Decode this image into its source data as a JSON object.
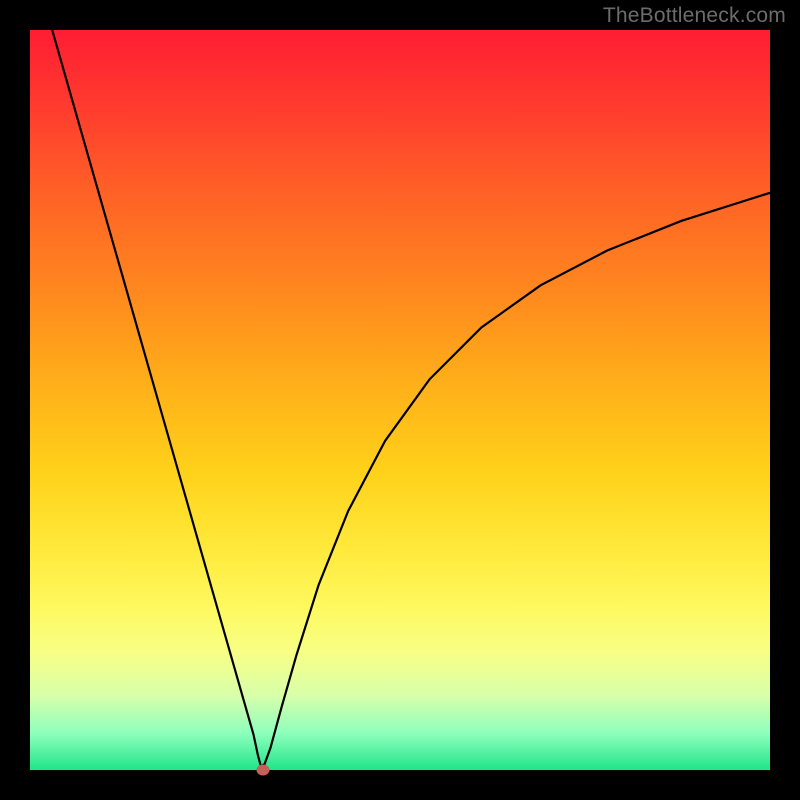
{
  "watermark": "TheBottleneck.com",
  "chart_data": {
    "type": "line",
    "title": "",
    "xlabel": "",
    "ylabel": "",
    "xlim": [
      0,
      100
    ],
    "ylim": [
      0,
      100
    ],
    "grid": false,
    "legend": false,
    "background_gradient": {
      "top_color": "#ff1d33",
      "mid_color": "#ffe93b",
      "bottom_color": "#1fe589"
    },
    "marker": {
      "x": 31.5,
      "y": 0,
      "color": "#c46058"
    },
    "series": [
      {
        "name": "curve",
        "color": "#000000",
        "x": [
          3.0,
          6.0,
          9.0,
          12.0,
          15.0,
          18.0,
          21.0,
          24.0,
          27.0,
          29.0,
          30.2,
          30.8,
          31.2,
          31.7,
          32.5,
          34.0,
          36.0,
          39.0,
          43.0,
          48.0,
          54.0,
          61.0,
          69.0,
          78.0,
          88.0,
          100.0
        ],
        "y": [
          100.0,
          89.5,
          79.0,
          68.5,
          58.0,
          47.5,
          37.0,
          26.5,
          16.0,
          9.0,
          4.8,
          2.0,
          0.5,
          0.8,
          3.0,
          8.5,
          15.5,
          25.0,
          35.0,
          44.5,
          52.8,
          59.8,
          65.5,
          70.2,
          74.2,
          78.0
        ]
      }
    ]
  }
}
